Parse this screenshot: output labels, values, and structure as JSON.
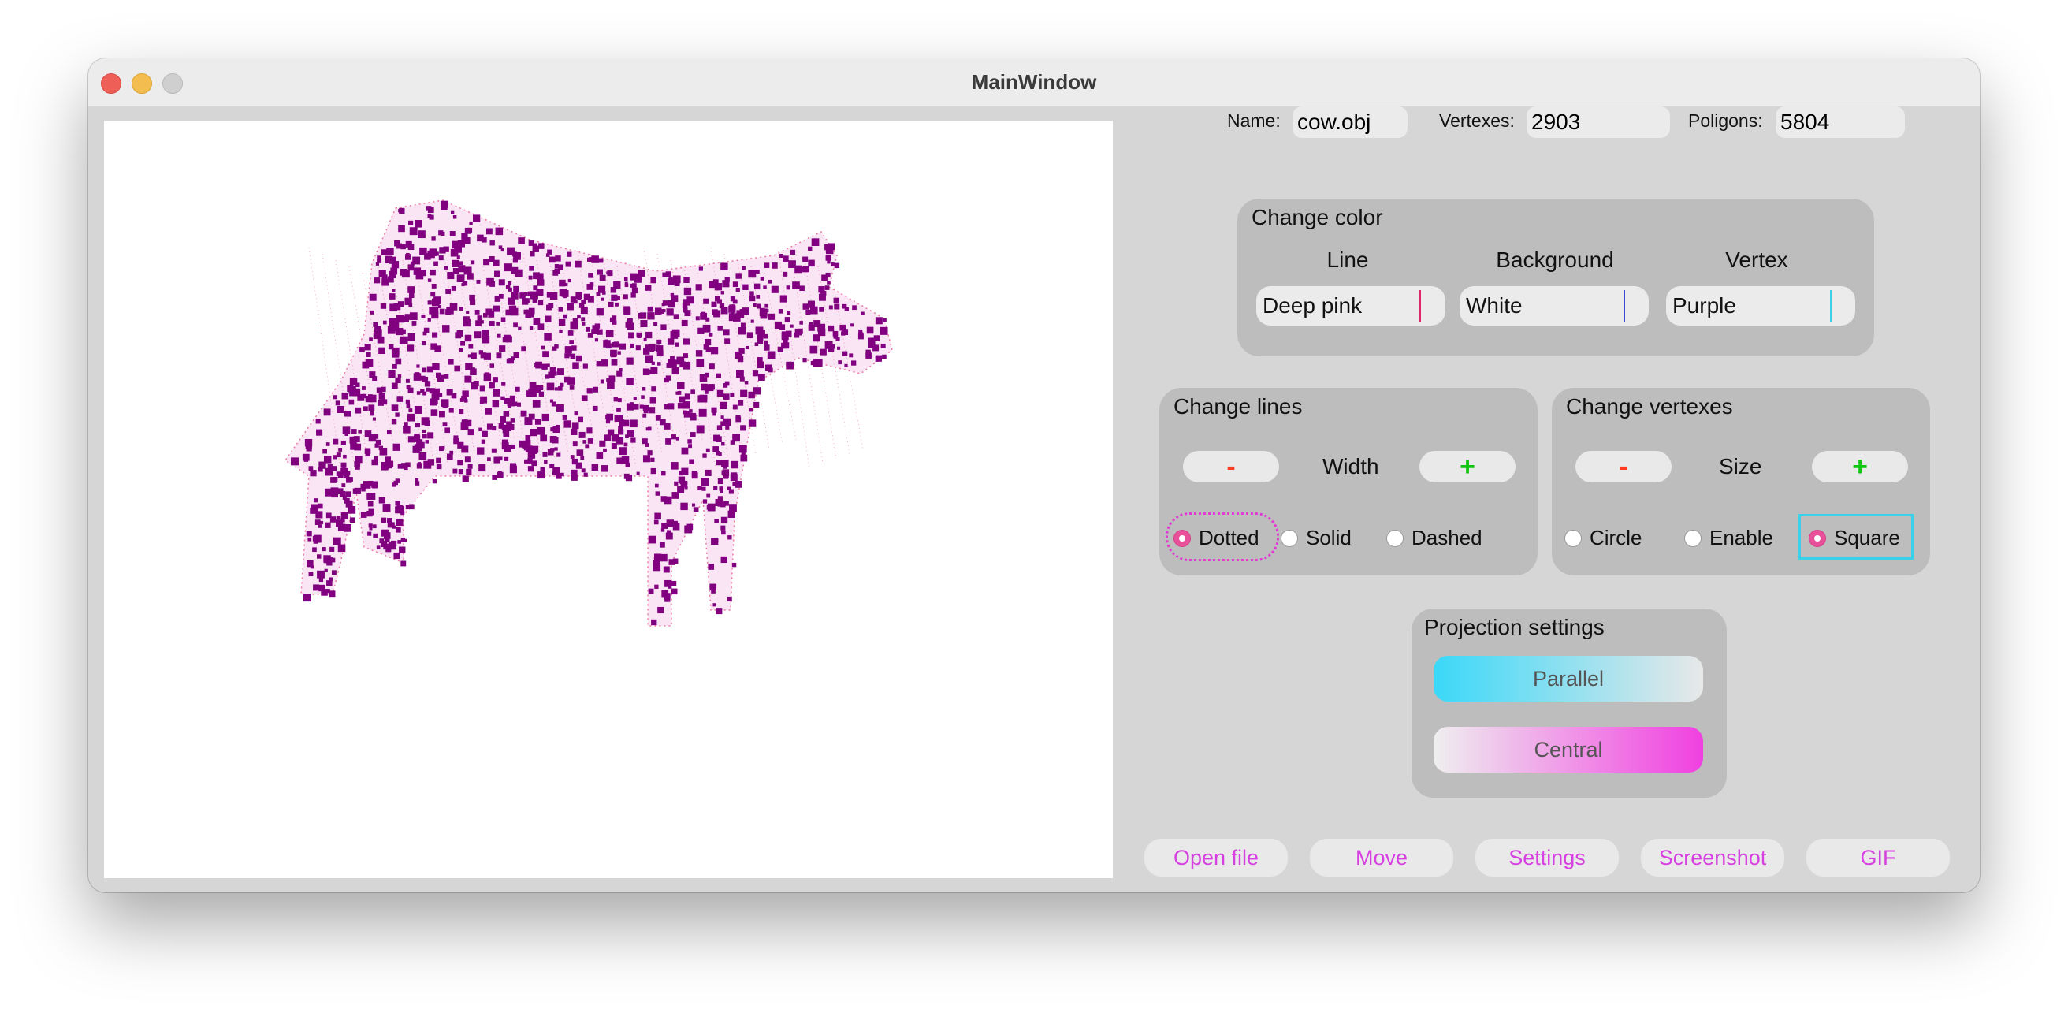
{
  "window": {
    "title": "MainWindow"
  },
  "model_info": {
    "name_label": "Name:",
    "name_value": "cow.obj",
    "vertexes_label": "Vertexes:",
    "vertexes_value": "2903",
    "polygons_label": "Poligons:",
    "polygons_value": "5804"
  },
  "change_color": {
    "title": "Change color",
    "line_label": "Line",
    "background_label": "Background",
    "vertex_label": "Vertex",
    "line_value": "Deep pink",
    "background_value": "White",
    "vertex_value": "Purple",
    "line_swatch": "#e0246b",
    "background_swatch": "#3a4bd8",
    "vertex_swatch": "#3ad0ec"
  },
  "change_lines": {
    "title": "Change lines",
    "minus_label": "-",
    "plus_label": "+",
    "width_label": "Width",
    "options": [
      "Dotted",
      "Solid",
      "Dashed"
    ],
    "selected": "Dotted"
  },
  "change_vertexes": {
    "title": "Change vertexes",
    "minus_label": "-",
    "plus_label": "+",
    "size_label": "Size",
    "options": [
      "Circle",
      "Enable",
      "Square"
    ],
    "selected": "Square"
  },
  "projection": {
    "title": "Projection settings",
    "parallel_label": "Parallel",
    "central_label": "Central"
  },
  "toolbar": {
    "open_file": "Open file",
    "move": "Move",
    "settings": "Settings",
    "screenshot": "Screenshot",
    "gif": "GIF"
  },
  "render": {
    "background_color": "#ffffff",
    "line_color": "#e0246b",
    "vertex_color": "#800080"
  }
}
